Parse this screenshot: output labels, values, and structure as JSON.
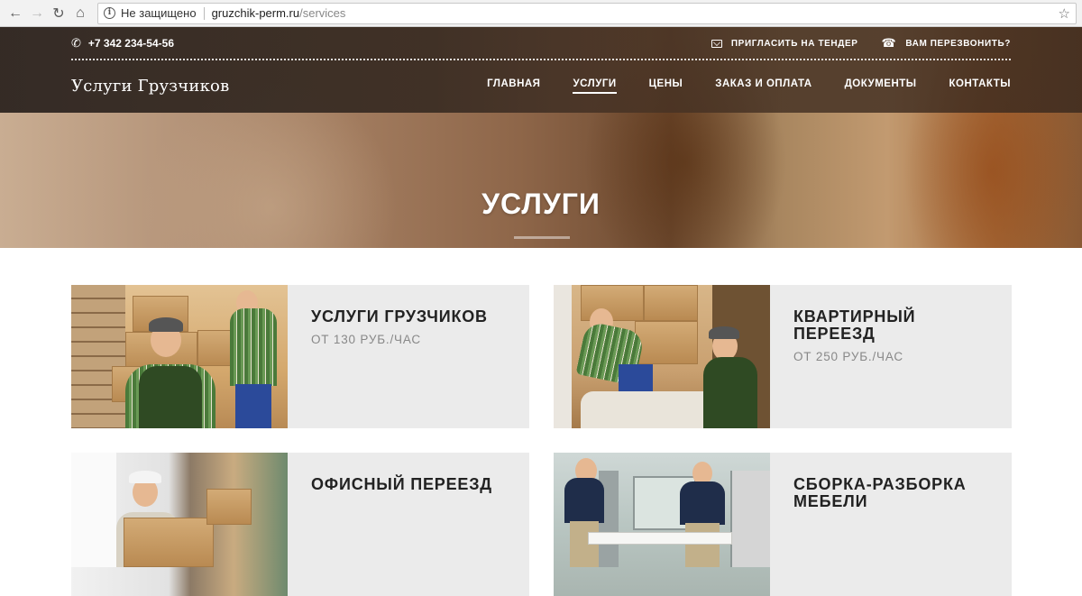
{
  "browser": {
    "security_label": "Не защищено",
    "url_host": "gruzchik-perm.ru",
    "url_path": "/services"
  },
  "topbar": {
    "phone": "+7 342 234-54-56",
    "tender_label": "ПРИГЛАСИТЬ НА ТЕНДЕР",
    "callback_label": "ВАМ ПЕРЕЗВОНИТЬ?"
  },
  "header": {
    "logo": "Услуги Грузчиков",
    "menu": [
      {
        "label": "ГЛАВНАЯ",
        "active": false
      },
      {
        "label": "УСЛУГИ",
        "active": true
      },
      {
        "label": "ЦЕНЫ",
        "active": false
      },
      {
        "label": "ЗАКАЗ И ОПЛАТА",
        "active": false
      },
      {
        "label": "ДОКУМЕНТЫ",
        "active": false
      },
      {
        "label": "КОНТАКТЫ",
        "active": false
      }
    ]
  },
  "hero": {
    "title": "УСЛУГИ"
  },
  "services": [
    {
      "title": "УСЛУГИ ГРУЗЧИКОВ",
      "price": "ОТ 130 РУБ./ЧАС"
    },
    {
      "title": "КВАРТИРНЫЙ ПЕРЕЕЗД",
      "price": "ОТ 250 РУБ./ЧАС"
    },
    {
      "title": "ОФИСНЫЙ ПЕРЕЕЗД",
      "price": ""
    },
    {
      "title": "СБОРКА-РАЗБОРКА МЕБЕЛИ",
      "price": ""
    }
  ],
  "colors": {
    "card_bg": "#ebebeb",
    "title_text": "#222222",
    "price_text": "#888888"
  }
}
